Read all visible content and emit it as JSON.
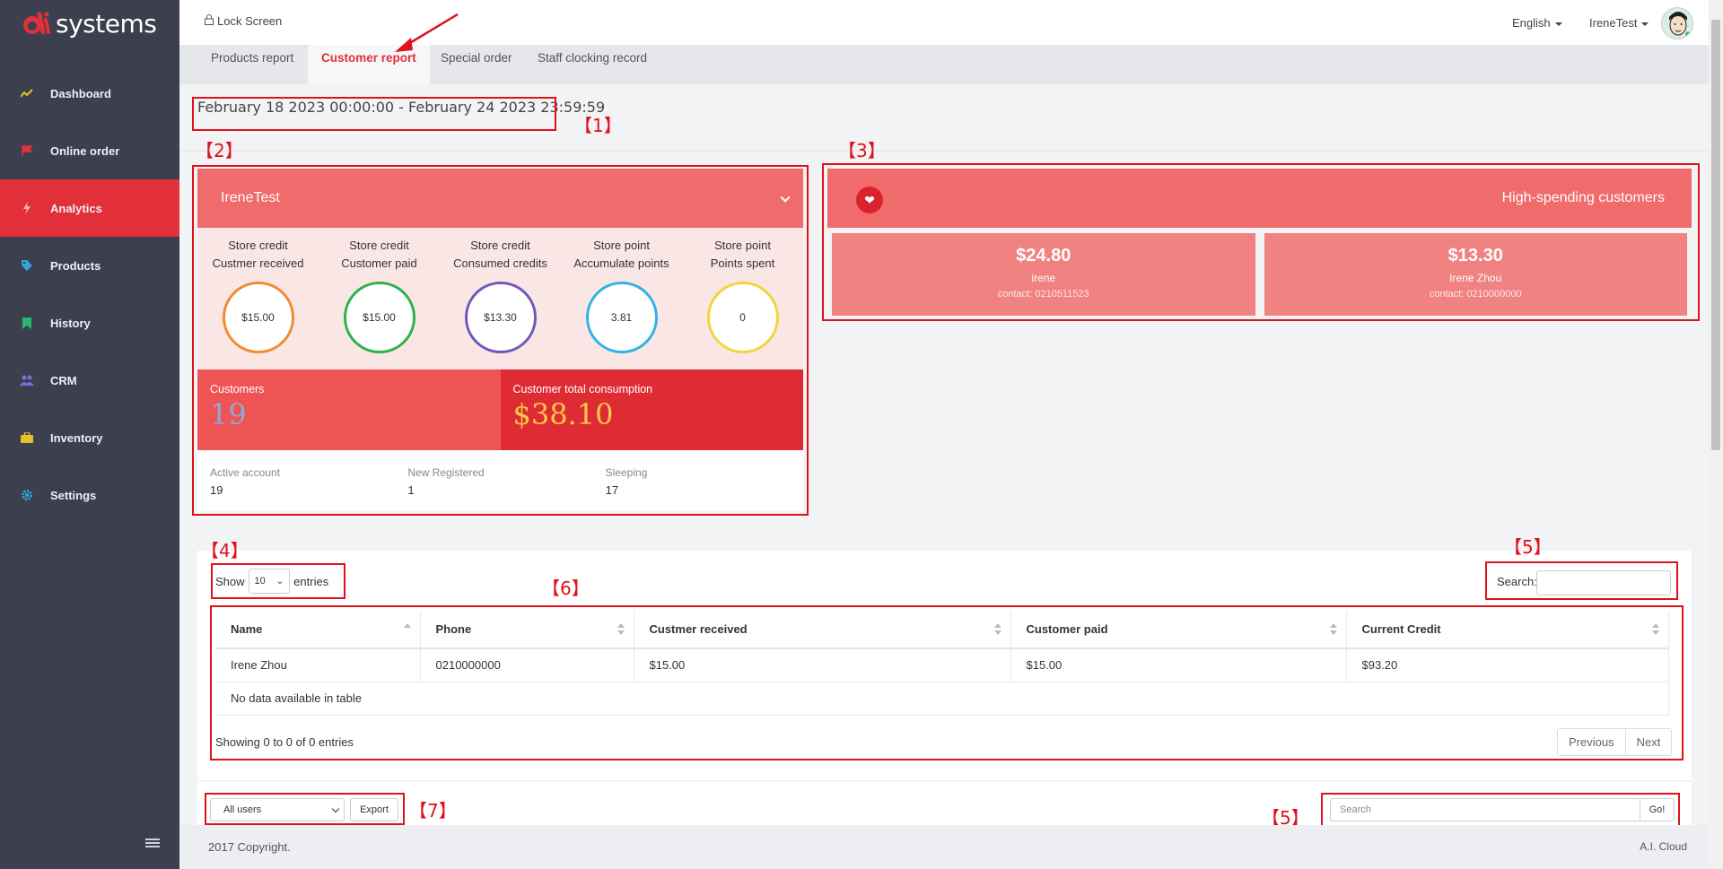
{
  "brand": {
    "logo_text": "systems"
  },
  "colors": {
    "accent": "#e2303a",
    "sidebar": "#3b3f4e",
    "panel_red": "#f06b6b"
  },
  "sidebar": {
    "items": [
      {
        "label": "Dashboard",
        "icon": "chart-line-icon",
        "color": "#e6c229"
      },
      {
        "label": "Online order",
        "icon": "flag-icon",
        "color": "#e2303a"
      },
      {
        "label": "Analytics",
        "icon": "bolt-icon",
        "color": "#f4a8a8"
      },
      {
        "label": "Products",
        "icon": "tag-icon",
        "color": "#3aa3d6"
      },
      {
        "label": "History",
        "icon": "bookmark-icon",
        "color": "#2bb673"
      },
      {
        "label": "CRM",
        "icon": "users-icon",
        "color": "#7c6cd6"
      },
      {
        "label": "Inventory",
        "icon": "briefcase-icon",
        "color": "#e6c229"
      },
      {
        "label": "Settings",
        "icon": "gear-icon",
        "color": "#3aa3d6"
      }
    ]
  },
  "header": {
    "lock_label": "Lock Screen",
    "language": "English",
    "user": "IreneTest"
  },
  "tabs": [
    "Products report",
    "Customer report",
    "Special order",
    "Staff clocking record"
  ],
  "date_range": "February 18 2023 00:00:00 - February 24 2023 23:59:59",
  "annotations": [
    "【1】",
    "【2】",
    "【3】",
    "【4】",
    "【5】",
    "【6】",
    "【7】",
    "【5】"
  ],
  "summary": {
    "store_name": "IreneTest",
    "stats": [
      {
        "t1": "Store credit",
        "t2": "Custmer received",
        "value": "$15.00",
        "color": "#f28a30"
      },
      {
        "t1": "Store credit",
        "t2": "Customer paid",
        "value": "$15.00",
        "color": "#2bb34b"
      },
      {
        "t1": "Store credit",
        "t2": "Consumed credits",
        "value": "$13.30",
        "color": "#7058b8"
      },
      {
        "t1": "Store point",
        "t2": "Accumulate points",
        "value": "3.81",
        "color": "#2fb3e3"
      },
      {
        "t1": "Store point",
        "t2": "Points spent",
        "value": "0",
        "color": "#f3d53a"
      }
    ],
    "customers_label": "Customers",
    "customers_value": "19",
    "consumption_label": "Customer total consumption",
    "consumption_value": "$38.10",
    "counts": [
      {
        "label": "Active account",
        "value": "19"
      },
      {
        "label": "New Registered",
        "value": "1"
      },
      {
        "label": "Sleeping",
        "value": "17"
      }
    ]
  },
  "high_spending": {
    "title": "High-spending customers",
    "cards": [
      {
        "amount": "$24.80",
        "name": "irene",
        "contact": "contact: 0210511523"
      },
      {
        "amount": "$13.30",
        "name": "Irene Zhou",
        "contact": "contact: 0210000000"
      }
    ]
  },
  "table": {
    "show_label": "Show",
    "entries_value": "10",
    "entries_label": "entries",
    "search_label": "Search:",
    "columns": [
      "Name",
      "Phone",
      "Custmer received",
      "Customer paid",
      "Current Credit"
    ],
    "rows": [
      [
        "Irene Zhou",
        "0210000000",
        "$15.00",
        "$15.00",
        "$93.20"
      ]
    ],
    "empty_text": "No data available in table",
    "showing_text": "Showing 0 to 0 of 0 entries",
    "prev_label": "Previous",
    "next_label": "Next"
  },
  "export": {
    "users_value": "All users",
    "export_label": "Export",
    "search_placeholder": "Search",
    "go_label": "Go!"
  },
  "footer": {
    "copyright": "2017 Copyright.",
    "version": "A.I. Cloud"
  }
}
